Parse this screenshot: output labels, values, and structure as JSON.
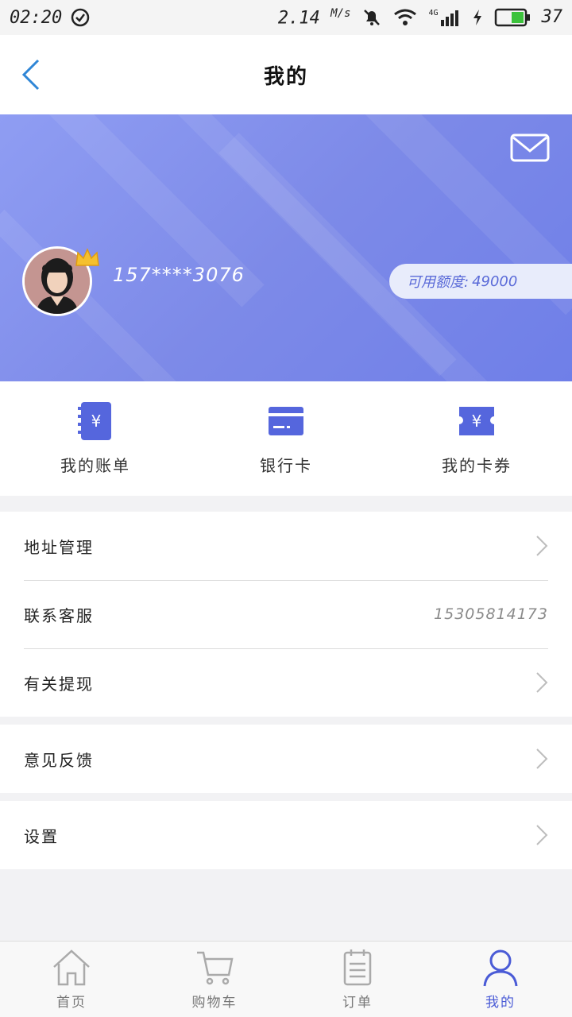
{
  "status_bar": {
    "time": "02:20",
    "net_speed": "2.14",
    "net_unit": "M/s",
    "network_type": "4G",
    "battery": "37"
  },
  "header": {
    "title": "我的"
  },
  "profile": {
    "phone": "157****3076",
    "credit_label": "可用额度:",
    "credit_value": "49000"
  },
  "quick_actions": [
    {
      "label": "我的账单",
      "icon": "bill-icon"
    },
    {
      "label": "银行卡",
      "icon": "bank-card-icon"
    },
    {
      "label": "我的卡券",
      "icon": "coupon-icon"
    }
  ],
  "menu": {
    "address": "地址管理",
    "service": "联系客服",
    "service_phone": "15305814173",
    "withdraw": "有关提现",
    "feedback": "意见反馈",
    "settings": "设置"
  },
  "tabs": [
    {
      "label": "首页",
      "icon": "home-icon"
    },
    {
      "label": "购物车",
      "icon": "cart-icon"
    },
    {
      "label": "订单",
      "icon": "order-icon"
    },
    {
      "label": "我的",
      "icon": "user-icon",
      "active": true
    }
  ],
  "colors": {
    "accent": "#4a5bd6",
    "banner": "#7d8ae8"
  }
}
